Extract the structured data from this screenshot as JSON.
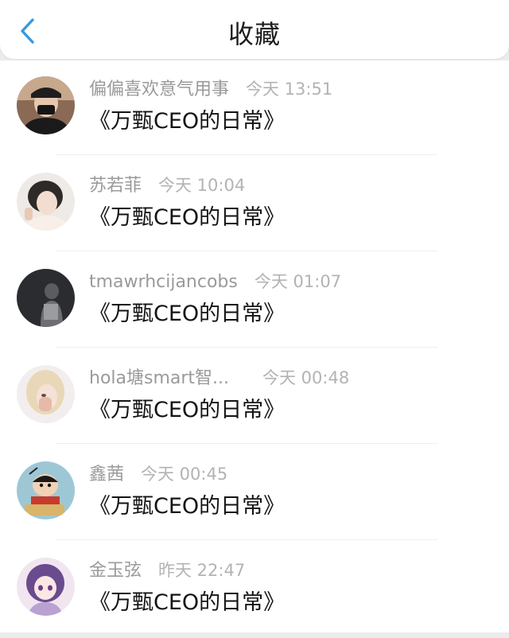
{
  "header": {
    "title": "收藏",
    "back_icon": "chevron-left-icon",
    "accent_color": "#3a98e0"
  },
  "items": [
    {
      "user": "偏偏喜欢意气用事",
      "time": "今天 13:51",
      "book": "《万甄CEO的日常》",
      "avatar": "avatar-photo-icon"
    },
    {
      "user": "苏若菲",
      "time": "今天 10:04",
      "book": "《万甄CEO的日常》",
      "avatar": "avatar-photo-icon"
    },
    {
      "user": "tmawrhcijancobs",
      "time": "今天 01:07",
      "book": "《万甄CEO的日常》",
      "avatar": "avatar-photo-icon"
    },
    {
      "user": "hola塘smart智...",
      "time": "今天 00:48",
      "book": "《万甄CEO的日常》",
      "avatar": "avatar-photo-icon"
    },
    {
      "user": "鑫茜",
      "time": "今天 00:45",
      "book": "《万甄CEO的日常》",
      "avatar": "avatar-cartoon-icon"
    },
    {
      "user": "金玉弦",
      "time": "昨天 22:47",
      "book": "《万甄CEO的日常》",
      "avatar": "avatar-anime-icon"
    }
  ]
}
